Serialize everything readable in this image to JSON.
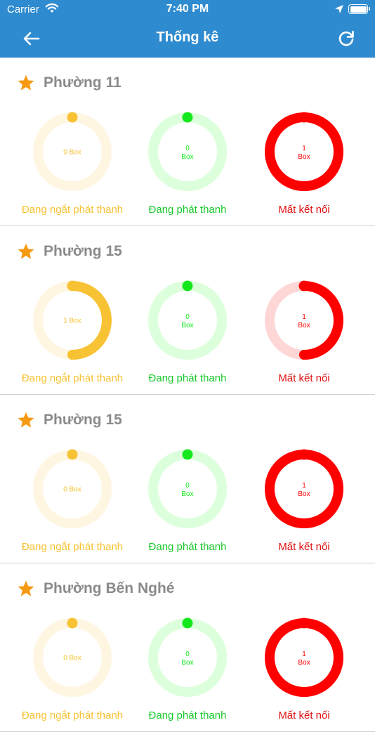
{
  "status_bar": {
    "carrier": "Carrier",
    "time": "7:40 PM"
  },
  "header": {
    "title": "Thống kê"
  },
  "colors": {
    "accent": "#2f8bd0",
    "star": "#f59a12",
    "yellow": "#f7c233",
    "yellow_track": "#fff6e2",
    "green": "#14e81c",
    "green_track": "#dcffdc",
    "red": "#ff0000",
    "red_track": "#ffd6d6"
  },
  "unit": "Box",
  "status_labels": [
    "Đang ngắt phát thanh",
    "Đang phát thanh",
    "Mất kết nối"
  ],
  "sections": [
    {
      "name": "Phường 11",
      "stats": [
        {
          "count": 0,
          "text": "0 Box",
          "fraction": 0
        },
        {
          "count": 0,
          "text": "0\nBox",
          "fraction": 0
        },
        {
          "count": 1,
          "text": "1\nBox",
          "fraction": 1
        }
      ]
    },
    {
      "name": "Phường 15",
      "stats": [
        {
          "count": 1,
          "text": "1 Box",
          "fraction": 0.5
        },
        {
          "count": 0,
          "text": "0\nBox",
          "fraction": 0
        },
        {
          "count": 1,
          "text": "1\nBox",
          "fraction": 0.5
        }
      ]
    },
    {
      "name": "Phường 15",
      "stats": [
        {
          "count": 0,
          "text": "0 Box",
          "fraction": 0
        },
        {
          "count": 0,
          "text": "0\nBox",
          "fraction": 0
        },
        {
          "count": 1,
          "text": "1\nBox",
          "fraction": 1
        }
      ]
    },
    {
      "name": "Phường Bến Nghé",
      "stats": [
        {
          "count": 0,
          "text": "0 Box",
          "fraction": 0
        },
        {
          "count": 0,
          "text": "0\nBox",
          "fraction": 0
        },
        {
          "count": 1,
          "text": "1\nBox",
          "fraction": 1
        }
      ]
    }
  ]
}
